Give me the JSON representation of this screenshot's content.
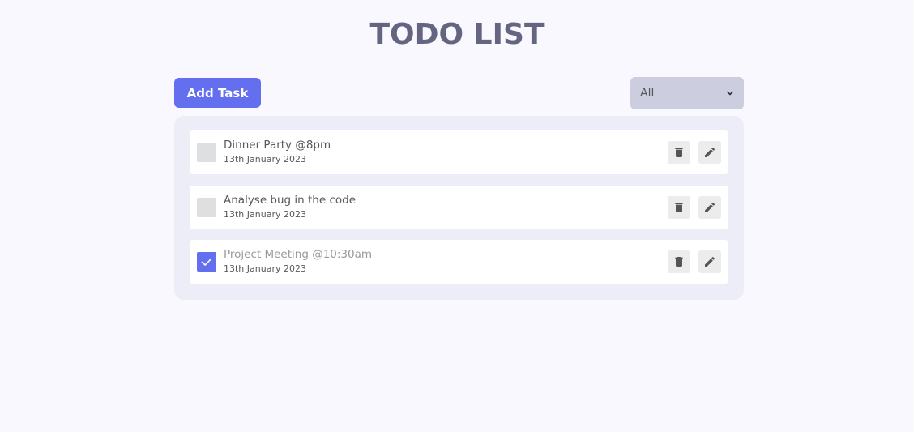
{
  "header": {
    "title": "TODO LIST"
  },
  "toolbar": {
    "add_label": "Add Task",
    "filter_value": "All",
    "filter_icon": "chevron-down-icon"
  },
  "colors": {
    "accent": "#646ff0",
    "background": "#f8f8fe",
    "panel": "#ecedf6",
    "title": "#646681",
    "select_bg": "#cccdde"
  },
  "tasks": [
    {
      "title": "Dinner Party @8pm",
      "date": "13th January 2023",
      "completed": false
    },
    {
      "title": "Analyse bug in the code",
      "date": "13th January 2023",
      "completed": false
    },
    {
      "title": "Project Meeting @10:30am",
      "date": "13th January 2023",
      "completed": true
    }
  ],
  "icons": {
    "delete": "trash-icon",
    "edit": "pencil-icon",
    "check": "checkmark-icon"
  }
}
